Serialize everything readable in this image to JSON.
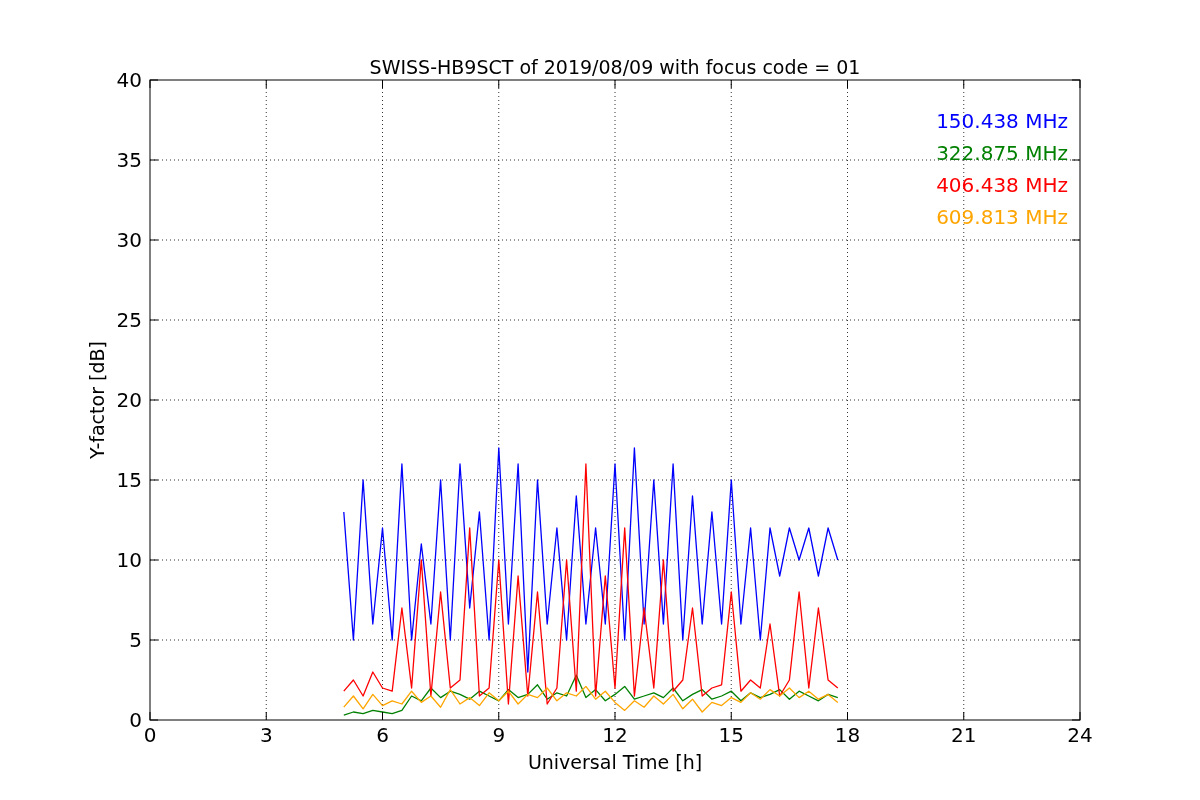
{
  "chart_data": {
    "type": "line",
    "grid": true,
    "title": "SWISS-HB9SCT of 2019/08/09 with focus code = 01",
    "xlabel": "Universal Time [h]",
    "ylabel": "Y-factor [dB]",
    "xlim": [
      0,
      24
    ],
    "ylim": [
      0,
      40
    ],
    "xticks": [
      0,
      3,
      6,
      9,
      12,
      15,
      18,
      21,
      24
    ],
    "yticks": [
      0,
      5,
      10,
      15,
      20,
      25,
      30,
      35,
      40
    ],
    "x": [
      5,
      5.25,
      5.5,
      5.75,
      6,
      6.25,
      6.5,
      6.75,
      7,
      7.25,
      7.5,
      7.75,
      8,
      8.25,
      8.5,
      8.75,
      9,
      9.25,
      9.5,
      9.75,
      10,
      10.25,
      10.5,
      10.75,
      11,
      11.25,
      11.5,
      11.75,
      12,
      12.25,
      12.5,
      12.75,
      13,
      13.25,
      13.5,
      13.75,
      14,
      14.25,
      14.5,
      14.75,
      15,
      15.25,
      15.5,
      15.75,
      16,
      16.25,
      16.5,
      16.75,
      17,
      17.25,
      17.5,
      17.75
    ],
    "series": [
      {
        "name": "150.438 MHz",
        "color": "#0000ff",
        "values": [
          13,
          5,
          15,
          6,
          12,
          5,
          16,
          5,
          11,
          6,
          15,
          5,
          16,
          7,
          13,
          5,
          17,
          6,
          16,
          3,
          15,
          6,
          12,
          5,
          14,
          6,
          12,
          6,
          16,
          5,
          17,
          6,
          15,
          6,
          16,
          5,
          14,
          6,
          13,
          6,
          15,
          6,
          12,
          5,
          12,
          9,
          12,
          10,
          12,
          9,
          12,
          10
        ]
      },
      {
        "name": "322.875 MHz",
        "color": "#008000",
        "values": [
          0.3,
          0.5,
          0.4,
          0.6,
          0.5,
          0.4,
          0.6,
          1.5,
          1.2,
          2,
          1.4,
          1.8,
          1.6,
          1.3,
          1.8,
          1.5,
          1.2,
          1.9,
          1.4,
          1.6,
          2.2,
          1.3,
          1.7,
          1.5,
          2.8,
          1.4,
          1.9,
          1.2,
          1.6,
          2.1,
          1.3,
          1.5,
          1.7,
          1.4,
          2,
          1.2,
          1.6,
          1.9,
          1.3,
          1.5,
          1.8,
          1.2,
          1.7,
          1.4,
          1.6,
          1.9,
          1.3,
          1.8,
          1.5,
          1.2,
          1.6,
          1.4
        ]
      },
      {
        "name": "406.438 MHz",
        "color": "#ff0000",
        "values": [
          1.8,
          2.5,
          1.5,
          3,
          2,
          1.8,
          7,
          2,
          10,
          1.5,
          8,
          2,
          2.5,
          12,
          1.5,
          2,
          10,
          1,
          9,
          1.5,
          8,
          1,
          2,
          10,
          1.8,
          16,
          1.5,
          9,
          2,
          12,
          1.5,
          7,
          2,
          10,
          1.8,
          2.5,
          7,
          1.5,
          2,
          2.2,
          8,
          1.8,
          2.5,
          2,
          6,
          1.5,
          2.5,
          8,
          2,
          7,
          2.5,
          2
        ]
      },
      {
        "name": "609.813 MHz",
        "color": "#ffa500",
        "values": [
          0.8,
          1.5,
          0.7,
          1.6,
          0.9,
          1.2,
          1,
          1.8,
          1.1,
          1.5,
          0.8,
          1.9,
          1,
          1.4,
          0.9,
          1.7,
          1.2,
          1.8,
          1.0,
          1.6,
          1.4,
          2,
          1.2,
          1.7,
          1.5,
          2.1,
          1.3,
          1.8,
          1.1,
          0.6,
          1.2,
          0.8,
          1.5,
          1,
          1.6,
          0.7,
          1.3,
          0.5,
          1.1,
          0.9,
          1.4,
          1.1,
          1.7,
          1.3,
          1.9,
          1.5,
          2,
          1.4,
          1.8,
          1.3,
          1.6,
          1.1
        ]
      }
    ]
  }
}
